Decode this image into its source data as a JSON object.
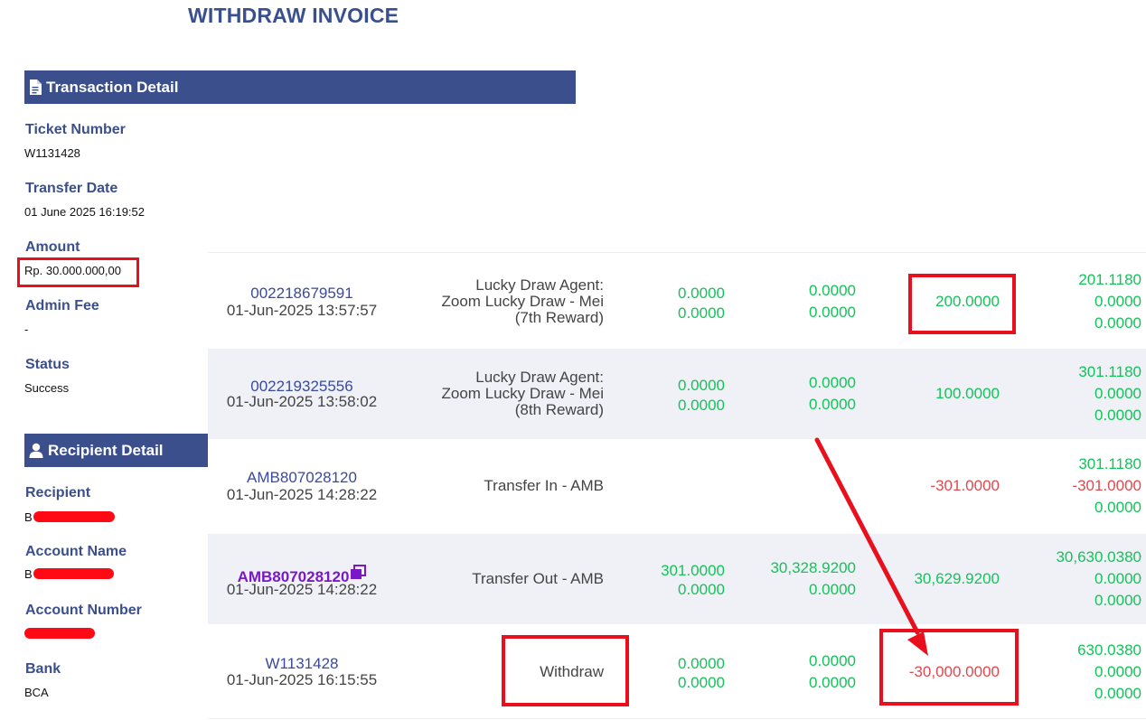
{
  "page": {
    "title": "WITHDRAW INVOICE"
  },
  "transaction": {
    "header": "Transaction Detail",
    "ticket_label": "Ticket Number",
    "ticket_value": "W1131428",
    "date_label": "Transfer Date",
    "date_value": "01 June 2025 16:19:52",
    "amount_label": "Amount",
    "amount_value": "Rp. 30.000.000,00",
    "fee_label": "Admin Fee",
    "fee_value": "-",
    "status_label": "Status",
    "status_value": "Success"
  },
  "recipient": {
    "header": "Recipient Detail",
    "recipient_label": "Recipient",
    "recipient_value": "B",
    "account_name_label": "Account Name",
    "account_name_value": "B",
    "account_number_label": "Account Number",
    "bank_label": "Bank",
    "bank_value": "BCA"
  },
  "rows": [
    {
      "ref": "002218679591",
      "date": "01-Jun-2025 13:57:57",
      "desc": [
        "Lucky Draw Agent:",
        "Zoom Lucky Draw - Mei",
        "(7th Reward)"
      ],
      "c1": [
        "0.0000",
        "0.0000"
      ],
      "c2": [
        "0.0000",
        "0.0000"
      ],
      "c3": "200.0000",
      "c4": [
        "201.1180",
        "0.0000",
        "0.0000"
      ]
    },
    {
      "ref": "002219325556",
      "date": "01-Jun-2025 13:58:02",
      "desc": [
        "Lucky Draw Agent:",
        "Zoom Lucky Draw - Mei",
        "(8th Reward)"
      ],
      "c1": [
        "0.0000",
        "0.0000"
      ],
      "c2": [
        "0.0000",
        "0.0000"
      ],
      "c3": "100.0000",
      "c4": [
        "301.1180",
        "0.0000",
        "0.0000"
      ]
    },
    {
      "ref": "AMB807028120",
      "date": "01-Jun-2025 14:28:22",
      "desc": [
        "Transfer In - AMB"
      ],
      "c3": "-301.0000",
      "c4": [
        "301.1180",
        "-301.0000",
        "0.0000"
      ]
    },
    {
      "ref": "AMB807028120",
      "date": "01-Jun-2025 14:28:22",
      "desc": [
        "Transfer Out - AMB"
      ],
      "c1": [
        "301.0000",
        "0.0000"
      ],
      "c2": [
        "30,328.9200",
        "0.0000"
      ],
      "c3": "30,629.9200",
      "c4": [
        "30,630.0380",
        "0.0000",
        "0.0000"
      ]
    },
    {
      "ref": "W1131428",
      "date": "01-Jun-2025 16:15:55",
      "desc": [
        "Withdraw"
      ],
      "c1": [
        "0.0000",
        "0.0000"
      ],
      "c2": [
        "0.0000",
        "0.0000"
      ],
      "c3": "-30,000.0000",
      "c4": [
        "630.0380",
        "0.0000",
        "0.0000"
      ]
    }
  ],
  "colors": {
    "accent": "#3b4f8c",
    "positive": "#15c25a",
    "negative": "#e0484f",
    "annotation": "#e8101c"
  },
  "icons": {
    "transaction": "document-icon",
    "recipient": "user-icon",
    "copy": "copy-icon"
  }
}
